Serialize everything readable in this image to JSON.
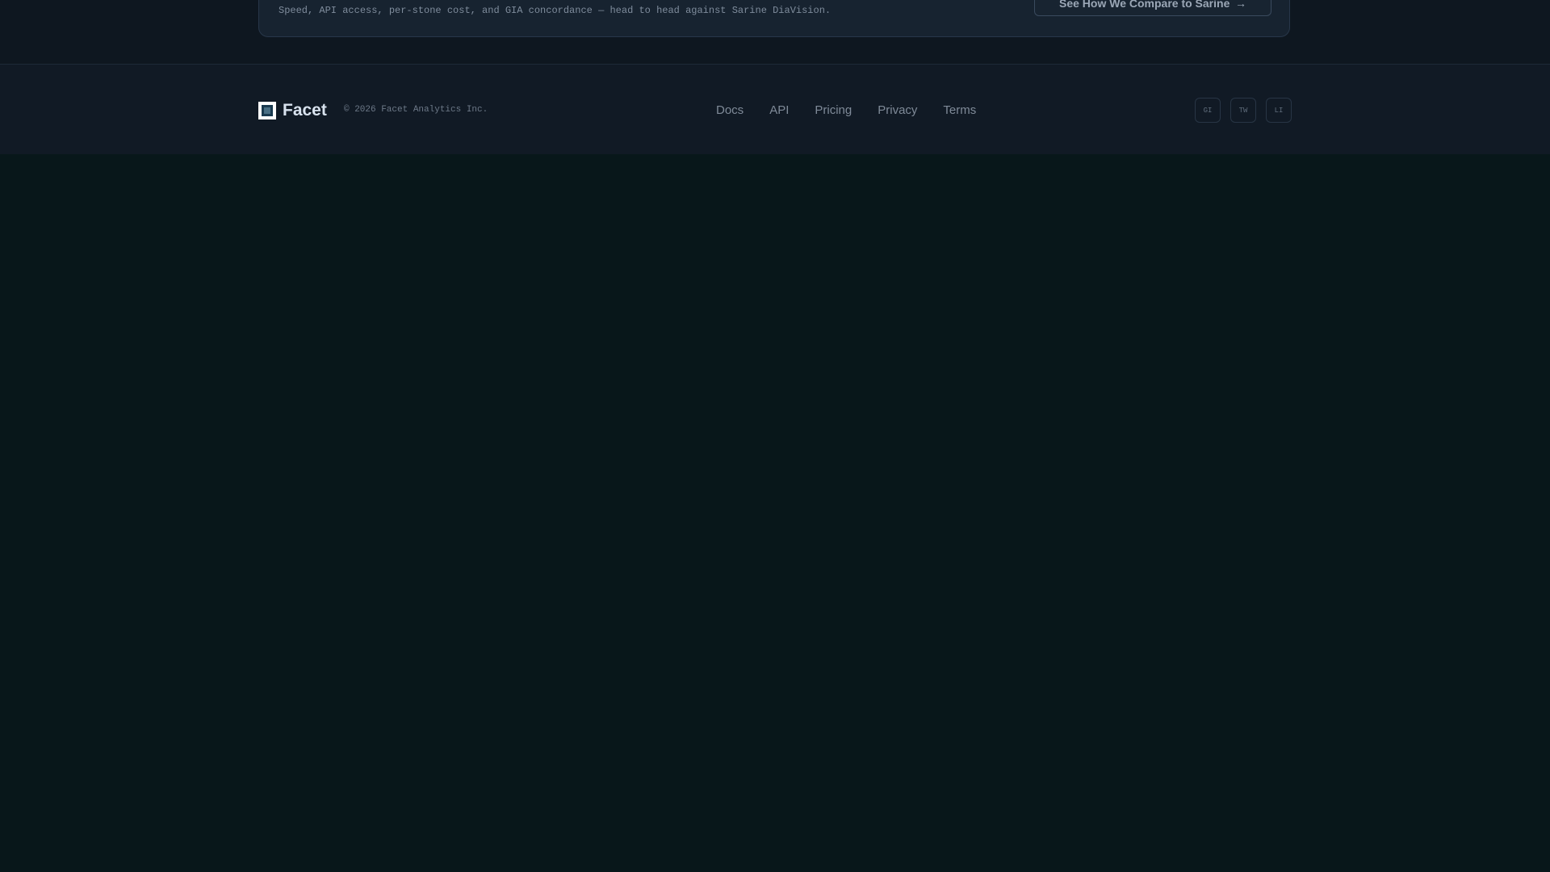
{
  "compare_card": {
    "description": "Speed, API access, per-stone cost, and GIA concordance — head to head against Sarine DiaVision.",
    "button_label": "See How We Compare to Sarine",
    "button_arrow": "→"
  },
  "footer": {
    "brand": "Facet",
    "copyright": "© 2026 Facet Analytics Inc.",
    "nav": [
      "Docs",
      "API",
      "Pricing",
      "Privacy",
      "Terms"
    ],
    "socials": [
      {
        "label": "GI",
        "icon": "github-icon"
      },
      {
        "label": "TW",
        "icon": "twitter-icon"
      },
      {
        "label": "LI",
        "icon": "linkedin-icon"
      }
    ]
  },
  "colors": {
    "page_background": "#08171a",
    "footer_background": "#111a25",
    "card_background": "#172330"
  }
}
